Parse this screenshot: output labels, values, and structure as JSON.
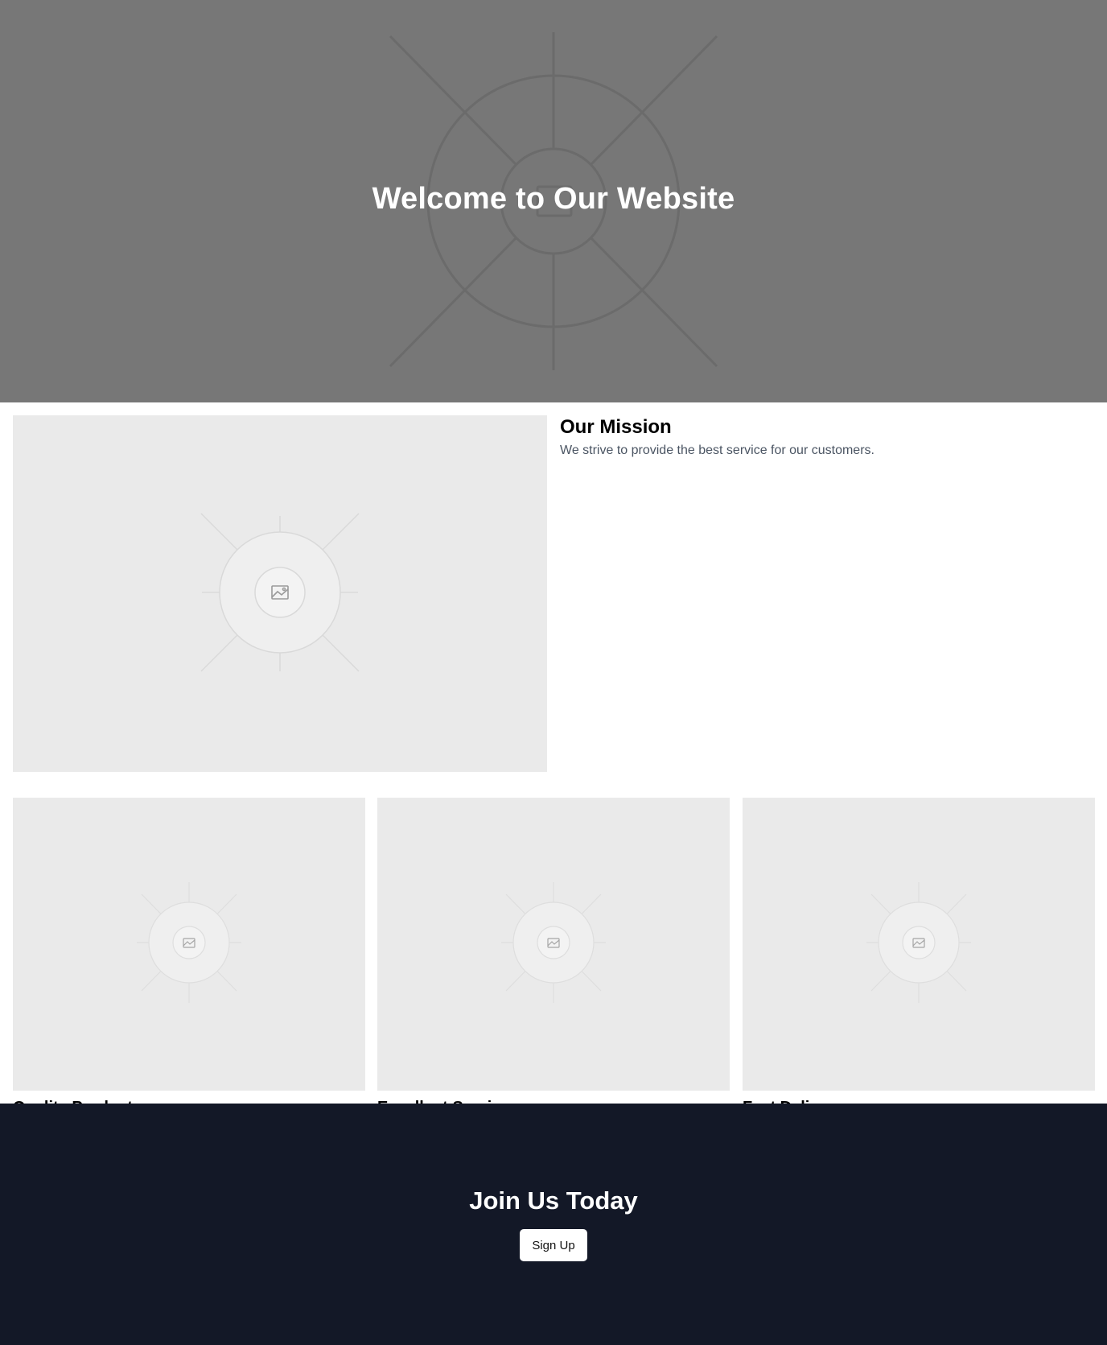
{
  "hero": {
    "title": "Welcome to Our Website",
    "background_color": "#777777",
    "image_icon": "image-placeholder-icon"
  },
  "mission": {
    "title": "Our Mission",
    "text": "We strive to provide the best service for our customers.",
    "image_icon": "image-placeholder-icon"
  },
  "cards": [
    {
      "title": "Quality Products",
      "image_icon": "image-placeholder-icon"
    },
    {
      "title": "Excellent Service",
      "image_icon": "image-placeholder-icon"
    },
    {
      "title": "Fast Delivery",
      "image_icon": "image-placeholder-icon"
    }
  ],
  "cta": {
    "title": "Join Us Today",
    "button_label": "Sign Up",
    "background_color": "#131827"
  }
}
